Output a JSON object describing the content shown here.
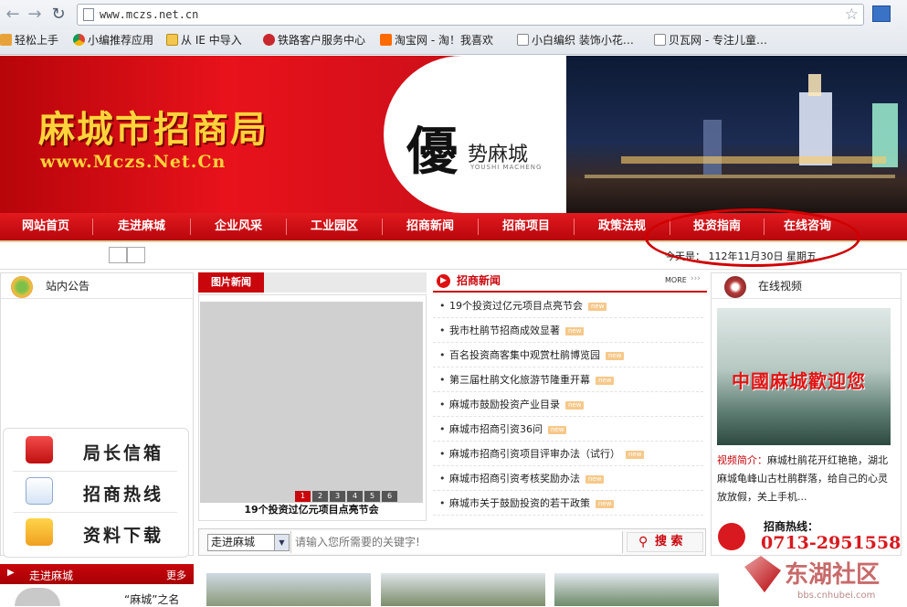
{
  "browser": {
    "url": "www.mczs.net.cn",
    "bookmarks": [
      "轻松上手",
      "小编推荐应用",
      "从 IE 中导入",
      "铁路客户服务中心",
      "淘宝网 - 淘！我喜欢",
      "小白编织 装饰小花…",
      "贝瓦网 - 专注儿童…"
    ]
  },
  "banner": {
    "title": "麻城市招商局",
    "domain": "www.Mczs.Net.Cn",
    "big_char": "優",
    "slogan": "势麻城",
    "slogan_en": "YOUSHI MACHENG"
  },
  "nav": [
    "网站首页",
    "走进麻城",
    "企业风采",
    "工业园区",
    "招商新闻",
    "招商项目",
    "政策法规",
    "投资指南",
    "在线咨询"
  ],
  "date_bar": {
    "label": "今天是：",
    "date": "112年11月30日 星期五"
  },
  "left": {
    "notice_title": "站内公告",
    "features": [
      "局长信箱",
      "招商热线",
      "资料下载"
    ],
    "section_title": "走进麻城",
    "more": "更多",
    "intro": "“麻城”之名"
  },
  "photo_news": {
    "title": "图片新闻",
    "caption": "19个投资过亿元项目点亮节会",
    "pages": [
      "1",
      "2",
      "3",
      "4",
      "5",
      "6"
    ]
  },
  "invest_news": {
    "title": "招商新闻",
    "more": "MORE",
    "new_tag": "new",
    "items": [
      "19个投资过亿元项目点亮节会",
      "我市杜鹃节招商成效显著",
      "百名投资商客集中观赏杜鹃博览园",
      "第三届杜鹃文化旅游节隆重开幕",
      "麻城市鼓励投资产业目录",
      "麻城市招商引资36问",
      "麻城市招商引资项目评审办法（试行）",
      "麻城市招商引资考核奖励办法",
      "麻城市关于鼓励投资的若干政策"
    ]
  },
  "search": {
    "select": "走进麻城",
    "placeholder": "请输入您所需要的关键字!",
    "button": "搜 索"
  },
  "video": {
    "title": "在线视频",
    "screen_text": "中國麻城歡迎您",
    "intro_label": "视频简介：",
    "intro_text": "麻城杜鹃花开红艳艳，湖北麻城龟峰山古杜鹃群落，给自己的心灵放放假，关上手机..."
  },
  "hotline": {
    "label": "招商热线：",
    "number": "0713-2951558"
  },
  "watermark": {
    "brand": "东湖社区",
    "site": "bbs.cnhubei.com"
  }
}
